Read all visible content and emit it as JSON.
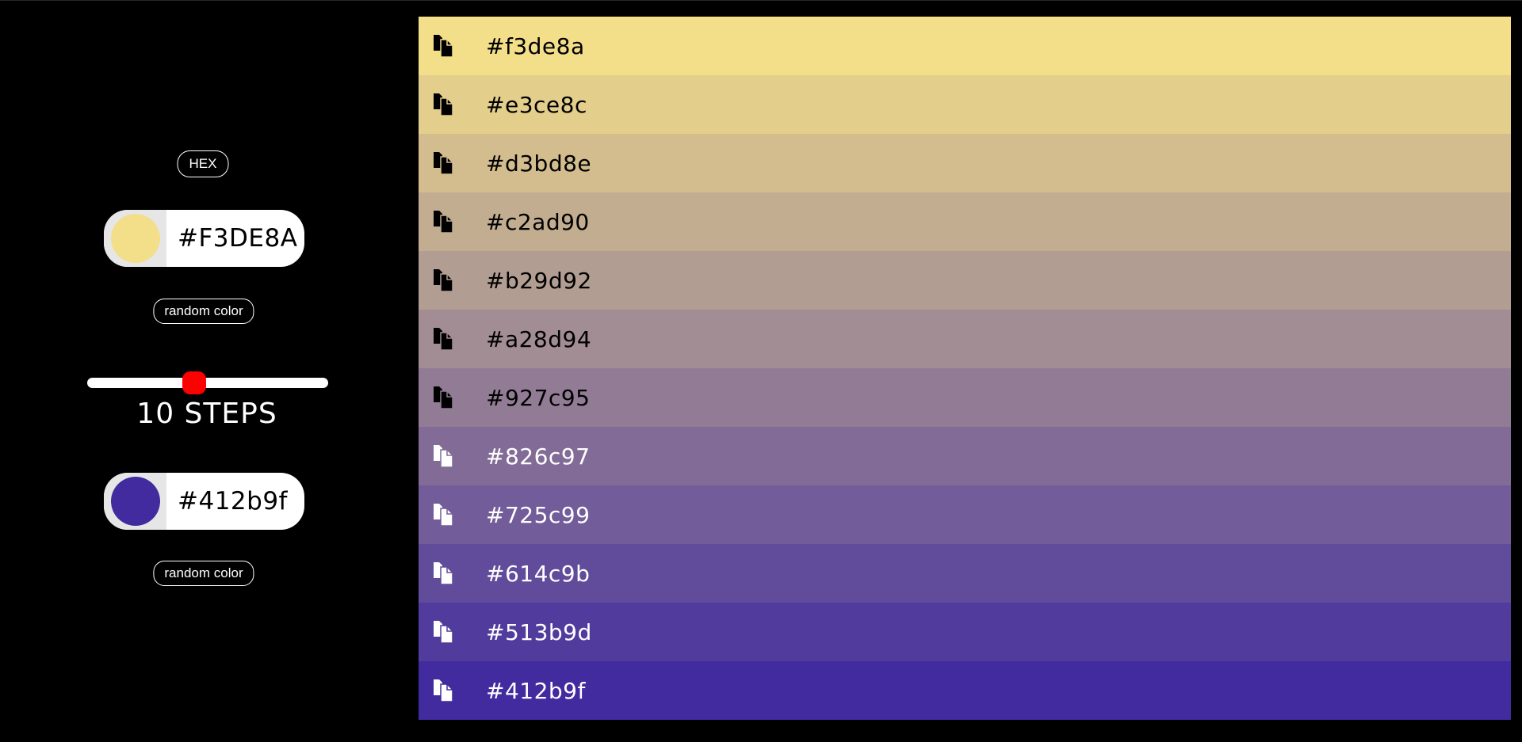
{
  "format_button": {
    "label": "HEX"
  },
  "start_color": {
    "value": "#F3DE8A",
    "swatch": "#f3de8a"
  },
  "end_color": {
    "value": "#412b9f",
    "swatch": "#412b9f"
  },
  "random_button_label": "random color",
  "steps": {
    "value": 10,
    "min": 2,
    "max": 20,
    "label": "10 STEPS"
  },
  "gradient": [
    {
      "hex": "#f3de8a",
      "bg": "#f3de8a",
      "fg": "#000000"
    },
    {
      "hex": "#e3ce8c",
      "bg": "#e3ce8c",
      "fg": "#000000"
    },
    {
      "hex": "#d3bd8e",
      "bg": "#d3bd8e",
      "fg": "#000000"
    },
    {
      "hex": "#c2ad90",
      "bg": "#c2ad90",
      "fg": "#000000"
    },
    {
      "hex": "#b29d92",
      "bg": "#b29d92",
      "fg": "#000000"
    },
    {
      "hex": "#a28d94",
      "bg": "#a28d94",
      "fg": "#000000"
    },
    {
      "hex": "#927c95",
      "bg": "#927c95",
      "fg": "#000000"
    },
    {
      "hex": "#826c97",
      "bg": "#826c97",
      "fg": "#ffffff"
    },
    {
      "hex": "#725c99",
      "bg": "#725c99",
      "fg": "#ffffff"
    },
    {
      "hex": "#614c9b",
      "bg": "#614c9b",
      "fg": "#ffffff"
    },
    {
      "hex": "#513b9d",
      "bg": "#513b9d",
      "fg": "#ffffff"
    },
    {
      "hex": "#412b9f",
      "bg": "#412b9f",
      "fg": "#ffffff"
    }
  ],
  "colors": {
    "background": "#000000",
    "slider_thumb": "#ff0000",
    "swatch_frame": "#e6e6e6"
  },
  "icons": {
    "copy": "copy-icon"
  }
}
